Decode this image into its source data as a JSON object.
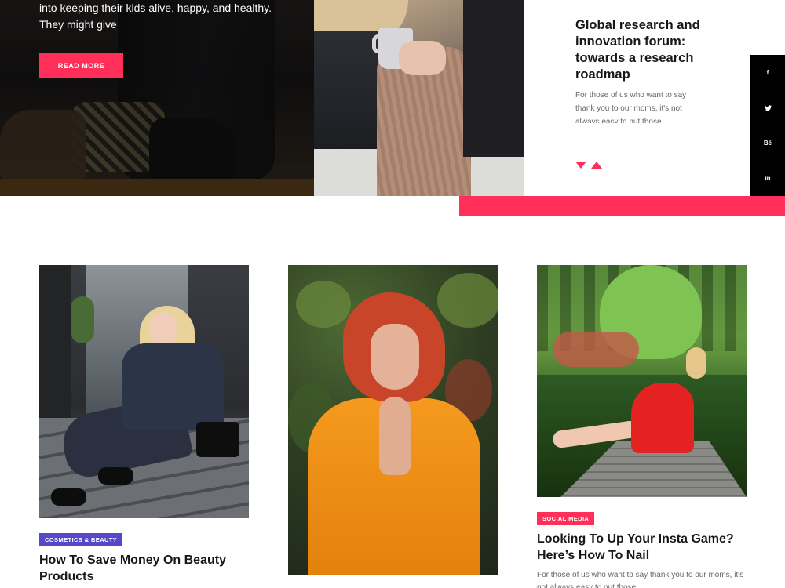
{
  "hero": {
    "intro_text": "into keeping their kids alive, happy, and healthy. They might give",
    "read_more_label": "READ MORE",
    "card": {
      "title": "Global research and innovation forum: towards a research roadmap",
      "excerpt": "For those of us who want to say thank you to our moms, it's not always easy to put those"
    }
  },
  "social": {
    "items": [
      {
        "glyph": "f",
        "icon": "facebook-icon"
      },
      {
        "glyph": "•",
        "icon": "twitter-icon"
      },
      {
        "glyph": "Bé",
        "icon": "behance-icon"
      },
      {
        "glyph": "in",
        "icon": "linkedin-icon"
      }
    ]
  },
  "cards": [
    {
      "category": "COSMETICS & BEAUTY",
      "category_color": "#5648c8",
      "title": "How To Save Money On Beauty Products"
    },
    {
      "category": "",
      "title": ""
    },
    {
      "category": "SOCIAL MEDIA",
      "category_color": "#ff2f5a",
      "title": "Looking To Up Your Insta Game? Here’s How To Nail",
      "excerpt": "For those of us who want to say thank you to our moms, it's not always easy to put those"
    }
  ],
  "colors": {
    "accent": "#ff2f5a",
    "tag_purple": "#5648c8",
    "social_bg": "#000000",
    "heading": "#171717"
  }
}
